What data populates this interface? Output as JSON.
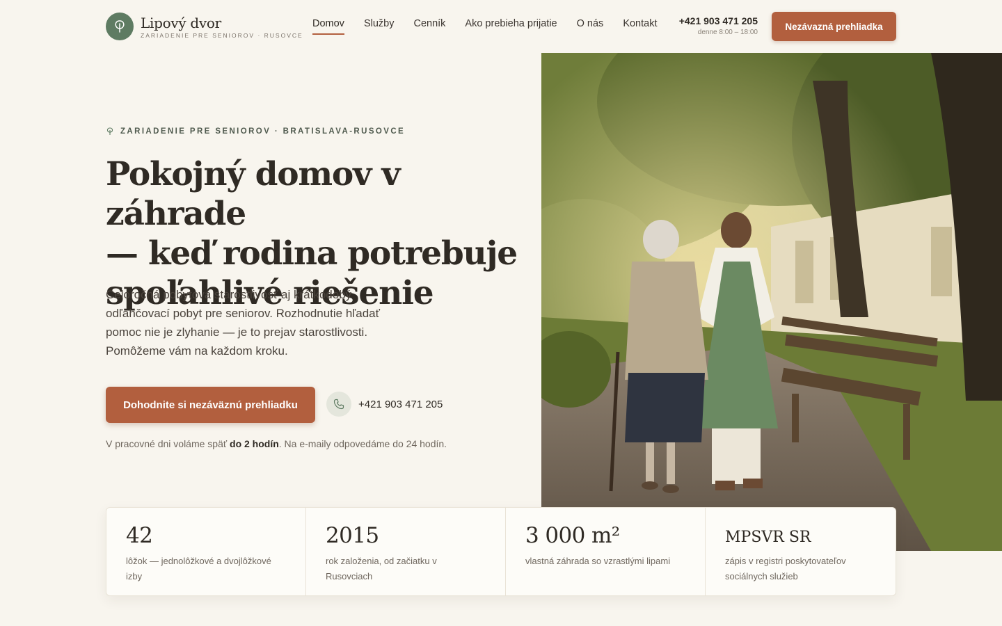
{
  "brand": {
    "name": "Lipový dvor",
    "subtitle": "ZARIADENIE PRE SENIOROV · RUSOVCE",
    "logo_icon": "linden-leaf-icon",
    "accent": "#b25f3e",
    "green": "#5e7b62"
  },
  "nav": {
    "items": [
      {
        "label": "Domov",
        "active": true
      },
      {
        "label": "Služby"
      },
      {
        "label": "Cenník"
      },
      {
        "label": "Ako prebieha prijatie"
      },
      {
        "label": "O nás"
      },
      {
        "label": "Kontakt"
      }
    ]
  },
  "header": {
    "phone": "+421 903 471 205",
    "hours": "denne 8:00 – 18:00",
    "cta": "Nezávazná prehliadka"
  },
  "hero": {
    "eyebrow": "ZARIADENIE PRE SENIOROV · BRATISLAVA-RUSOVCE",
    "eyebrow_icon": "leaf-icon",
    "title_line1": "Pokojný domov v záhrade",
    "title_line2": "— keď rodina potrebuje",
    "title_line3": "spoľahlivé riešenie",
    "desc_line1": "Celoročná pobytová starostlivosť aj krátkodobý",
    "desc_line2": "odľahčovací pobyt pre seniorov. Rozhodnutie hľadať",
    "desc_line3": "pomoc nie je zlyhanie — je to prejav starostlivosti.",
    "desc_line4": "Pomôžeme vám na každom kroku.",
    "cta": "Dohodnite si nezáväznú prehliadku",
    "phone": "+421 903 471 205",
    "phone_icon": "phone-icon",
    "callback_pre": "V pracovné dni voláme späť ",
    "callback_bold": "do 2 hodín",
    "callback_post": ". Na e-maily odpovedáme do 24 hodín.",
    "image_alt": "photo-caregiver-with-senior-in-garden"
  },
  "stats": [
    {
      "value": "42",
      "label": "lôžok — jednolôžkové a dvojlôžkové izby"
    },
    {
      "value": "2015",
      "label": "rok založenia, od začiatku v Rusovciach"
    },
    {
      "value": "3 000 m²",
      "label": "vlastná záhrada so vzrastlými lipami"
    },
    {
      "value": "MPSVR SR",
      "label": "zápis v registri poskytovateľov sociálnych služieb"
    }
  ]
}
